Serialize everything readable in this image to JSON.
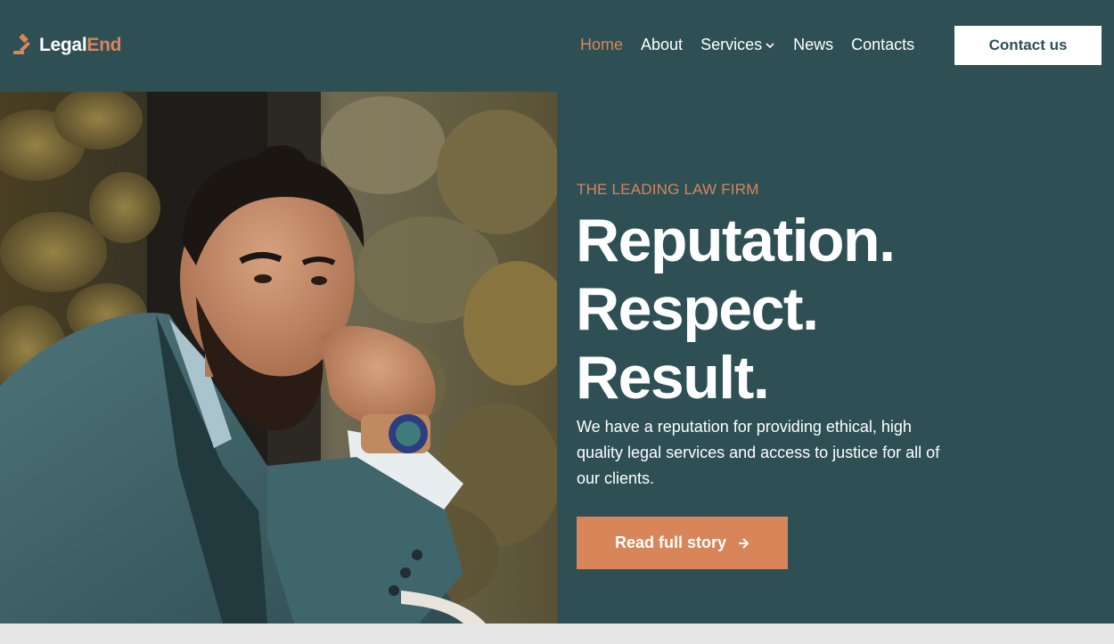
{
  "brand": {
    "name_part1": "Legal",
    "name_part2": "End",
    "icon": "gavel-icon",
    "colors": {
      "primary": "#2e5055",
      "accent": "#d8855a",
      "white": "#ffffff"
    }
  },
  "nav": {
    "items": [
      {
        "label": "Home",
        "active": true
      },
      {
        "label": "About",
        "active": false
      },
      {
        "label": "Services",
        "active": false,
        "icon": "chevron-down-icon"
      },
      {
        "label": "News",
        "active": false
      },
      {
        "label": "Contacts",
        "active": false
      }
    ],
    "cta_label": "Contact us"
  },
  "hero": {
    "eyebrow": "THE LEADING LAW FIRM",
    "headline": [
      "Reputation.",
      "Respect.",
      "Result."
    ],
    "body": "We have a reputation for providing ethical, high quality legal services and access to justice for all of our clients.",
    "button_label": "Read full story",
    "button_icon": "arrow-right-icon"
  }
}
